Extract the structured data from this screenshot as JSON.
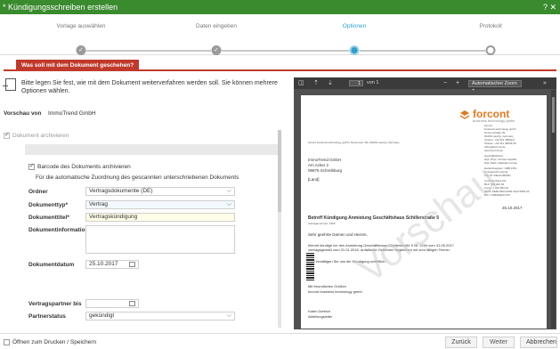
{
  "window": {
    "title": "* Kündigungsschreiben erstellen",
    "controls": "? ✕"
  },
  "wizard": {
    "steps": [
      {
        "label": "Vorlage auswählen",
        "state": "done"
      },
      {
        "label": "Daten eingeben",
        "state": "done"
      },
      {
        "label": "Optionen",
        "state": "current"
      },
      {
        "label": "Protokoll",
        "state": "open"
      }
    ]
  },
  "tab": {
    "label": "Was soll mit dem Dokument geschehen?"
  },
  "info": {
    "text": "Bitte legen Sie fest, wie mit dem Dokument weiterverfahren werden soll. Sie können mehrere Optionen wählen."
  },
  "form": {
    "vorschau_label": "Vorschau von",
    "vorschau_value": "ImmoTrend GmbH",
    "archivieren_label": "Dokument archivieren",
    "barcode_label": "Barcode des Dokuments archivieren",
    "zuordnung_text": "Für die automatische Zuordnung des gescannten unterschriebenen Dokuments",
    "ordner_label": "Ordner",
    "ordner_value": "Vertragsdokumente (DE)",
    "dokumenttyp_label": "Dokumenttyp*",
    "dokumenttyp_value": "Vertrag",
    "dokumenttitel_label": "Dokumenttitel*",
    "dokumenttitel_value": "Vertragskündigung",
    "dokumentinfo_label": "Dokumentinformation",
    "dokumentdatum_label": "Dokumentdatum",
    "dokumentdatum_value": "25.10.2017",
    "vertragspartner_label": "Vertragspartner bis",
    "partnerstatus_label": "Partnerstatus",
    "partnerstatus_value": "gekündigt"
  },
  "viewer": {
    "page_num": "1",
    "page_of": "von 1",
    "zoom_label": "Automatischer Zoom",
    "watermark": "Vorschau",
    "doc": {
      "logo": "forcont",
      "logo_sub": "business technology gmbh",
      "sender_line": "forcont business technology gmbh | Nonnenstr. 39 | 04229 Leipzig | Germany",
      "recipient": [
        "ImmoTrend GmbH",
        "Am Acker 2",
        "09876 Schreibburg",
        "[Land]"
      ],
      "company_block": [
        "forcont",
        "business technology gmbh",
        "Nonnenstraße 39",
        "04229 Leipzig, Germany",
        "Telefon: +49 341 48503-0",
        "Telefax: +49 341 48503-99",
        "office@forcont.de",
        "www.forcont.de",
        "Geschäftsführer",
        "Dipl.-Phys. Christa Gaudlitz",
        "Dipl.-Math. Matthias Kordon",
        "Handelsregister: HRB 1351",
        "Amtsgericht Leipzig",
        "USt-ID: DE141399251",
        "Commerzbank AG",
        "BLZ: 860 400 00",
        "Konto: 1 226 894 00",
        "IBAN: DE82 8604 0000 0122 6894 00",
        "BIC: COBADEFFXXX"
      ],
      "date": "25.10.2017",
      "subject": "Betreff Kündigung Anmietung Geschäftshaus Schillerstraße 5",
      "contract_no": "Vertragsnummer: 1254",
      "salutation": "Sehr geehrte Damen und Herren,",
      "body": [
        "hiermit kündige ich den Anmietung Geschäftshaus Schillerstraße 5 Nr. 1254 vom 31.05.2017",
        "vertragsgemäß zum 31.01.2018. Anfallende Gebühren begleichen wir zum fälligen Termin."
      ],
      "confirm": "Bitte bestätigen Sie uns die Kündigung schriftlich.",
      "closing": "Mit freundlichen Grüßen",
      "closing_company": "forcont business technology gmbh",
      "signer": "Katrin Dietrich",
      "signer_role": "Abteilungsleiter"
    }
  },
  "bottom": {
    "print_label": "Öffnen zum Drucken / Speichern",
    "back": "Zurück",
    "next": "Weiter",
    "cancel": "Abbrechen"
  }
}
